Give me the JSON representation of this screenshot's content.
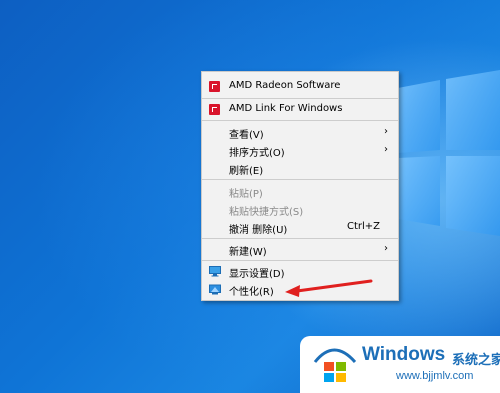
{
  "context_menu": {
    "items": [
      {
        "label": "AMD Radeon Software",
        "icon": "amd-icon"
      },
      {
        "label": "AMD Link For Windows",
        "icon": "amd-icon"
      },
      {
        "label": "查看(V)",
        "submenu": true
      },
      {
        "label": "排序方式(O)",
        "submenu": true
      },
      {
        "label": "刷新(E)"
      },
      {
        "label": "粘贴(P)",
        "disabled": true
      },
      {
        "label": "粘贴快捷方式(S)",
        "disabled": true
      },
      {
        "label": "撤消 删除(U)",
        "shortcut": "Ctrl+Z"
      },
      {
        "label": "新建(W)",
        "submenu": true
      },
      {
        "label": "显示设置(D)",
        "icon": "display-settings-icon"
      },
      {
        "label": "个性化(R)",
        "icon": "personalize-icon"
      }
    ],
    "arrow_glyph": "›"
  },
  "watermark": {
    "title": "Windows",
    "subtitle": "系统之家",
    "url": "www.bjjmlv.com"
  },
  "colors": {
    "desktop_blue": "#0a6fd0",
    "menu_bg": "#f2f2f2",
    "amd_red": "#d9142b",
    "annotation_red": "#e0201f",
    "watermark_blue": "#1d6fb8"
  }
}
